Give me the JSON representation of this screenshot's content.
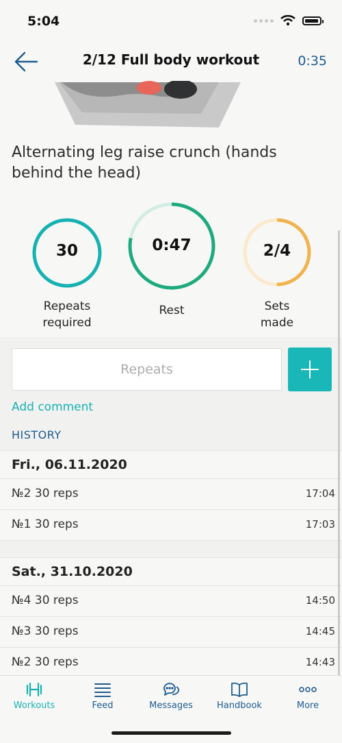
{
  "status": {
    "time": "5:04"
  },
  "nav": {
    "title": "2/12 Full body workout",
    "timer": "0:35"
  },
  "exercise": {
    "title": "Alternating leg raise crunch (hands behind the head)"
  },
  "stats": {
    "repeats": {
      "value": "30",
      "label_line1": "Repeats",
      "label_line2": "required",
      "progress": 1.0,
      "color": "#17b1b1"
    },
    "rest": {
      "value": "0:47",
      "label": "Rest",
      "progress": 0.78,
      "color": "#1fa97f",
      "track_color": "#d3ede4"
    },
    "sets": {
      "value": "2/4",
      "label_line1": "Sets",
      "label_line2": "made",
      "progress": 0.5,
      "color": "#f2b34f",
      "track_color": "#fbe9cd"
    }
  },
  "input": {
    "placeholder": "Repeats",
    "value": ""
  },
  "add_comment": "Add comment",
  "history_label": "HISTORY",
  "history": [
    {
      "date": "Fri., 06.11.2020",
      "sets": [
        {
          "label": "№2 30 reps",
          "time": "17:04"
        },
        {
          "label": "№1 30 reps",
          "time": "17:03"
        }
      ]
    },
    {
      "date": "Sat., 31.10.2020",
      "sets": [
        {
          "label": "№4 30 reps",
          "time": "14:50"
        },
        {
          "label": "№3 30 reps",
          "time": "14:45"
        },
        {
          "label": "№2 30 reps",
          "time": "14:43"
        }
      ]
    }
  ],
  "tabs": [
    {
      "label": "Workouts",
      "icon": "dumbbell-icon",
      "active": true
    },
    {
      "label": "Feed",
      "icon": "list-icon",
      "active": false
    },
    {
      "label": "Messages",
      "icon": "chat-bubbles-icon",
      "active": false
    },
    {
      "label": "Handbook",
      "icon": "book-icon",
      "active": false
    },
    {
      "label": "More",
      "icon": "more-dots-icon",
      "active": false
    }
  ],
  "colors": {
    "accent": "#17b1b1",
    "nav_blue": "#1d5a8f"
  }
}
